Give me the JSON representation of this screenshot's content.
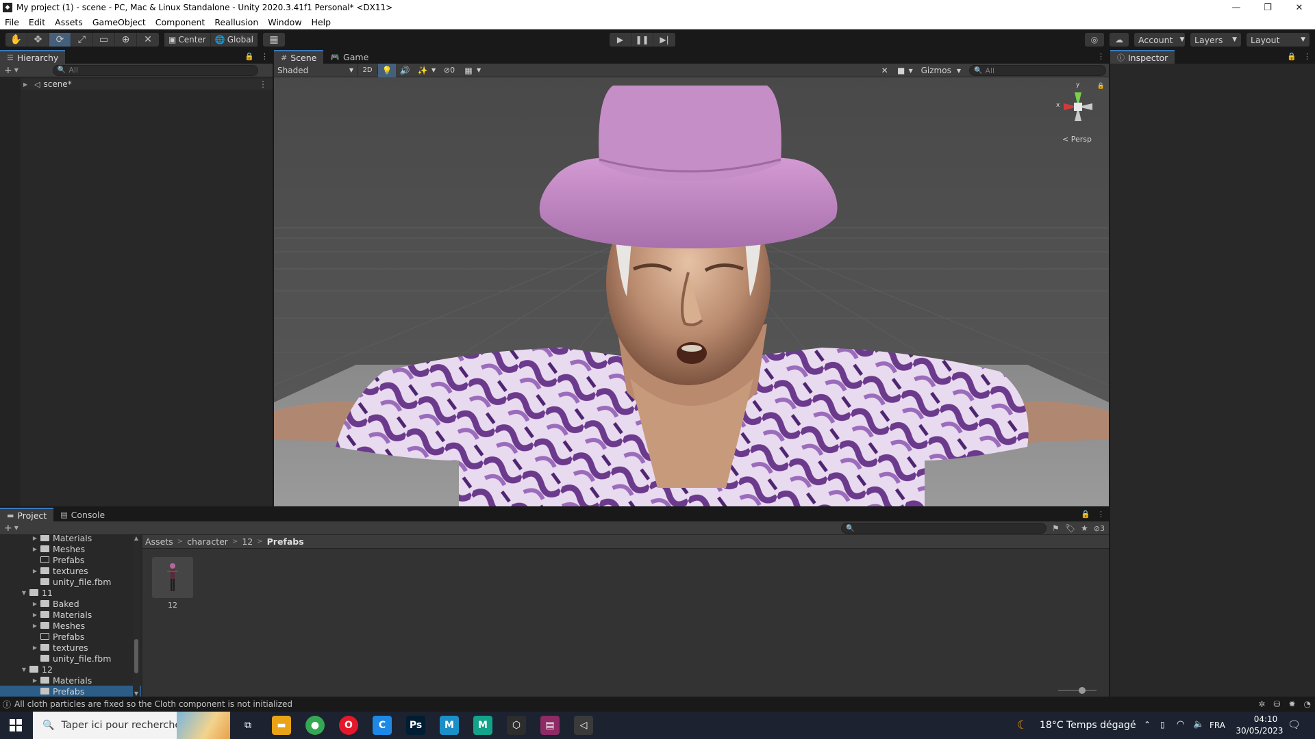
{
  "window": {
    "title": "My project (1) - scene - PC, Mac & Linux Standalone - Unity 2020.3.41f1 Personal* <DX11>",
    "app_icon": "unity-icon",
    "controls": [
      "minimize",
      "restore",
      "close"
    ]
  },
  "menu": [
    "File",
    "Edit",
    "Assets",
    "GameObject",
    "Component",
    "Reallusion",
    "Window",
    "Help"
  ],
  "toolbar": {
    "tools": [
      "hand-tool-icon",
      "move-tool-icon",
      "rotate-tool-icon",
      "scale-tool-icon",
      "rect-tool-icon",
      "transform-tool-icon",
      "custom-tool-icon"
    ],
    "active_tool": "rotate-tool-icon",
    "pivot": "Center",
    "space": "Global",
    "account": "Account",
    "layers": "Layers",
    "layout": "Layout"
  },
  "hierarchy": {
    "tab": "Hierarchy",
    "search_placeholder": "All",
    "scene": "scene*"
  },
  "scene_view": {
    "tabs": [
      "Scene",
      "Game"
    ],
    "active_tab": "Scene",
    "shading": "Shaded",
    "mode_2d": "2D",
    "hidden_count": "0",
    "gizmos": "Gizmos",
    "search_placeholder": "All",
    "gizmo": {
      "y": "y",
      "x": "x",
      "projection": "Persp"
    }
  },
  "inspector": {
    "tab": "Inspector"
  },
  "project": {
    "tabs": [
      "Project",
      "Console"
    ],
    "active_tab": "Project",
    "hidden_count": "3",
    "tree": [
      {
        "label": "Materials",
        "depth": 1,
        "arrow": "collapsed",
        "empty": false
      },
      {
        "label": "Meshes",
        "depth": 1,
        "arrow": "collapsed",
        "empty": false
      },
      {
        "label": "Prefabs",
        "depth": 1,
        "arrow": "none",
        "empty": true
      },
      {
        "label": "textures",
        "depth": 1,
        "arrow": "collapsed",
        "empty": false
      },
      {
        "label": "unity_file.fbm",
        "depth": 1,
        "arrow": "none",
        "empty": false
      },
      {
        "label": "11",
        "depth": 0,
        "arrow": "expanded",
        "empty": false
      },
      {
        "label": "Baked",
        "depth": 1,
        "arrow": "collapsed",
        "empty": false
      },
      {
        "label": "Materials",
        "depth": 1,
        "arrow": "collapsed",
        "empty": false
      },
      {
        "label": "Meshes",
        "depth": 1,
        "arrow": "collapsed",
        "empty": false
      },
      {
        "label": "Prefabs",
        "depth": 1,
        "arrow": "none",
        "empty": true
      },
      {
        "label": "textures",
        "depth": 1,
        "arrow": "collapsed",
        "empty": false
      },
      {
        "label": "unity_file.fbm",
        "depth": 1,
        "arrow": "none",
        "empty": false
      },
      {
        "label": "12",
        "depth": 0,
        "arrow": "expanded",
        "empty": false
      },
      {
        "label": "Materials",
        "depth": 1,
        "arrow": "collapsed",
        "empty": false
      },
      {
        "label": "Prefabs",
        "depth": 1,
        "arrow": "none",
        "empty": false,
        "selected": true
      }
    ],
    "breadcrumb": [
      "Assets",
      "character",
      "12",
      "Prefabs"
    ],
    "assets": [
      {
        "name": "12"
      }
    ]
  },
  "status": {
    "message": "All cloth particles are fixed so the Cloth component is not initialized"
  },
  "taskbar": {
    "search_placeholder": "Taper ici pour rechercher",
    "weather": "18°C  Temps dégagé",
    "language": "FRA",
    "time": "04:10",
    "date": "30/05/2023",
    "apps": [
      {
        "name": "task-view-icon"
      },
      {
        "name": "file-explorer-icon",
        "color": "#e8a317"
      },
      {
        "name": "chrome-icon",
        "color": "#34a853"
      },
      {
        "name": "opera-icon",
        "color": "#e3192b"
      },
      {
        "name": "ccleaner-icon",
        "color": "#1e88e5",
        "glyph": "C"
      },
      {
        "name": "photoshop-icon",
        "color": "#001d34",
        "glyph": "Ps"
      },
      {
        "name": "app-m-icon",
        "color": "#1b8fc8",
        "glyph": "M"
      },
      {
        "name": "app-m2-icon",
        "color": "#12a38a",
        "glyph": "M"
      },
      {
        "name": "unity-hub-icon",
        "color": "#2d2d2d"
      },
      {
        "name": "winrar-icon",
        "color": "#8e2a65"
      },
      {
        "name": "unity-editor-icon",
        "color": "#3a3a3a"
      }
    ]
  },
  "colors": {
    "accent": "#3a79bb",
    "panel": "#282828",
    "tab_active": "#3c3c3c",
    "hat": "#c68ec6",
    "shirt": "#8a5aa8"
  }
}
